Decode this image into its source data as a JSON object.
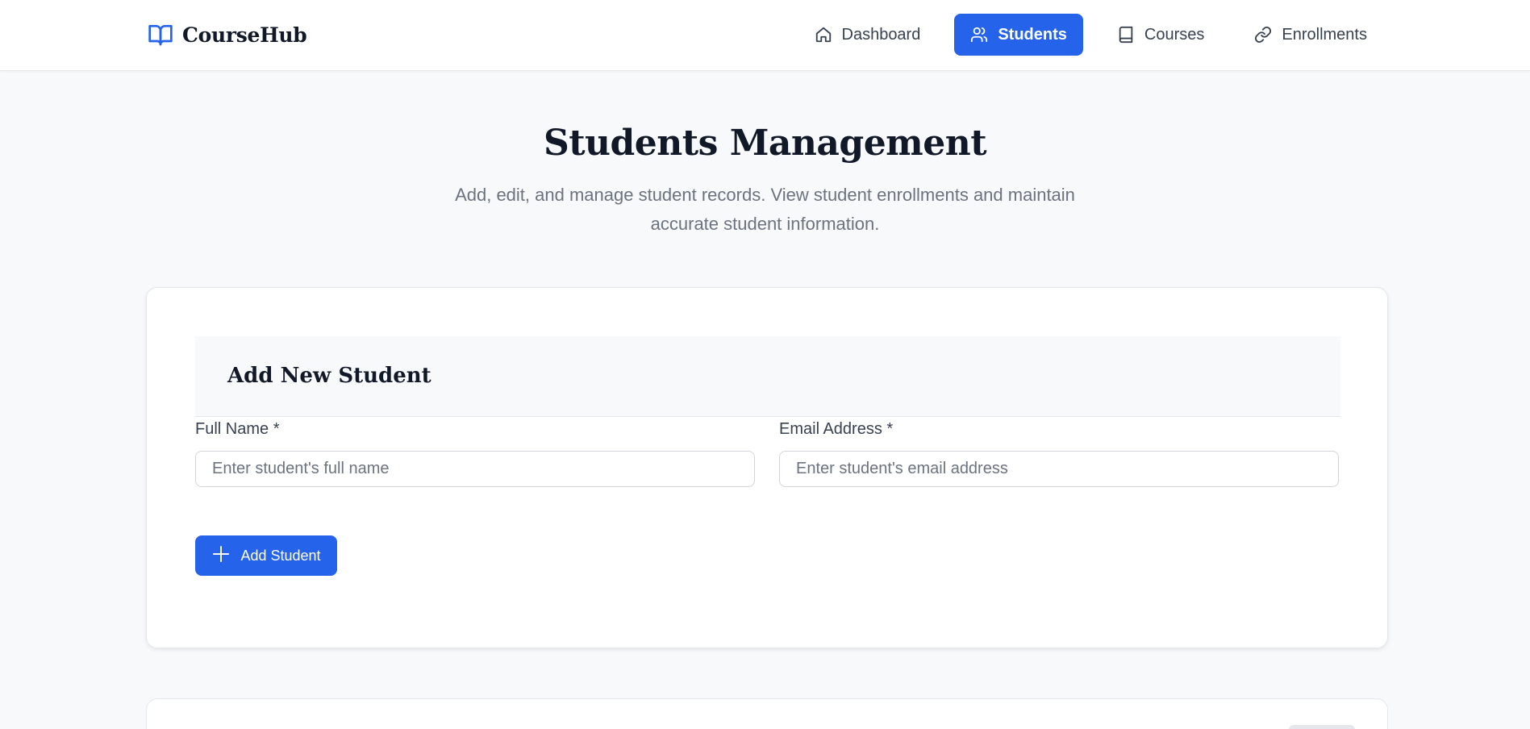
{
  "brand": {
    "name": "CourseHub",
    "icon": "open-book-icon",
    "accent": "#2563eb"
  },
  "nav": [
    {
      "label": "Dashboard",
      "icon": "home-icon",
      "active": false
    },
    {
      "label": "Students",
      "icon": "users-icon",
      "active": true
    },
    {
      "label": "Courses",
      "icon": "book-icon",
      "active": false
    },
    {
      "label": "Enrollments",
      "icon": "link-icon",
      "active": false
    }
  ],
  "page": {
    "title": "Students Management",
    "subtitle": "Add, edit, and manage student records. View student enrollments and maintain accurate student information."
  },
  "form": {
    "title": "Add New Student",
    "name_label": "Full Name *",
    "name_placeholder": "Enter student's full name",
    "name_value": "",
    "email_label": "Email Address *",
    "email_placeholder": "Enter student's email address",
    "email_value": "",
    "submit_label": "Add Student",
    "submit_icon": "plus-icon"
  },
  "colors": {
    "primary": "#2563eb",
    "background": "#f8f9fb",
    "text": "#111827",
    "muted": "#6b7280"
  }
}
